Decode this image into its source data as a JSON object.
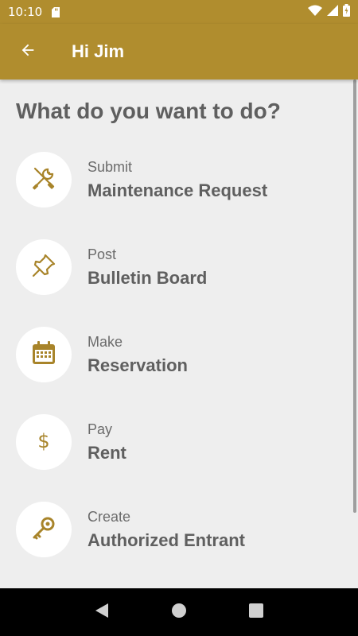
{
  "status_bar": {
    "time": "10:10",
    "icons": [
      "sd-card-icon",
      "wifi-icon",
      "signal-icon",
      "battery-icon"
    ]
  },
  "app_bar": {
    "title": "Hi Jim",
    "back_icon": "arrow-left-icon"
  },
  "main": {
    "heading": "What do you want to do?",
    "actions": [
      {
        "sub": "Submit",
        "label": "Maintenance Request",
        "icon": "tools-icon"
      },
      {
        "sub": "Post",
        "label": "Bulletin Board",
        "icon": "pushpin-icon"
      },
      {
        "sub": "Make",
        "label": "Reservation",
        "icon": "calendar-icon"
      },
      {
        "sub": "Pay",
        "label": "Rent",
        "icon": "dollar-icon"
      },
      {
        "sub": "Create",
        "label": "Authorized Entrant",
        "icon": "key-icon"
      }
    ]
  },
  "nav_bar": {
    "icons": [
      "back-triangle-icon",
      "home-circle-icon",
      "recents-square-icon"
    ]
  },
  "colors": {
    "brand": "#b08d2e",
    "background": "#eeeeee",
    "text": "#5f5f5f"
  }
}
